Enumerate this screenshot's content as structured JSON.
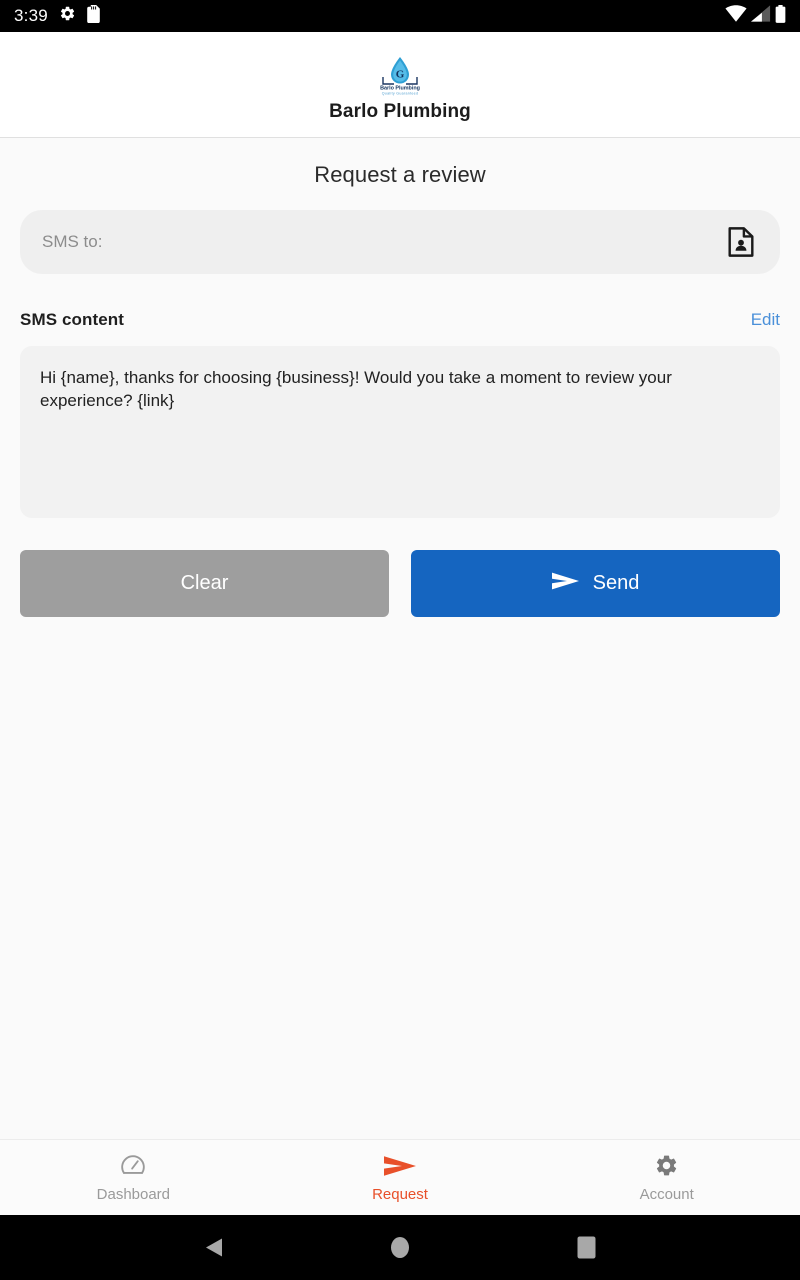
{
  "status_bar": {
    "time": "3:39",
    "icons": [
      "gear-icon",
      "sd-card-icon",
      "wifi-icon",
      "cellular-icon",
      "battery-icon"
    ]
  },
  "header": {
    "logo_alt": "Barlo Plumbing logo",
    "logo_text_primary": "Barlo Plumbing",
    "logo_text_secondary": "Quality Guaranteed",
    "business_name": "Barlo Plumbing"
  },
  "main": {
    "page_title": "Request a review",
    "sms_to": {
      "label": "SMS to:",
      "value": "",
      "placeholder": "SMS to:",
      "contact_icon": "contact-card-icon"
    },
    "sms_content": {
      "label": "SMS content",
      "edit_label": "Edit",
      "message": "Hi {name}, thanks for choosing {business}! Would you take a moment to review your experience? {link}"
    },
    "buttons": {
      "clear_label": "Clear",
      "send_label": "Send"
    }
  },
  "tab_bar": {
    "tabs": [
      {
        "label": "Dashboard",
        "icon": "speedometer-icon",
        "active": false
      },
      {
        "label": "Request",
        "icon": "send-arrow-icon",
        "active": true
      },
      {
        "label": "Account",
        "icon": "gear-icon",
        "active": false
      }
    ]
  },
  "system_nav": {
    "back": "back-triangle-icon",
    "home": "home-circle-icon",
    "recents": "recents-square-icon"
  },
  "colors": {
    "send_blue": "#1565c0",
    "clear_gray": "#9e9e9e",
    "edit_blue": "#4a90d9",
    "accent_orange": "#e8502a",
    "page_bg": "#fafafa",
    "field_bg": "#efefef"
  }
}
